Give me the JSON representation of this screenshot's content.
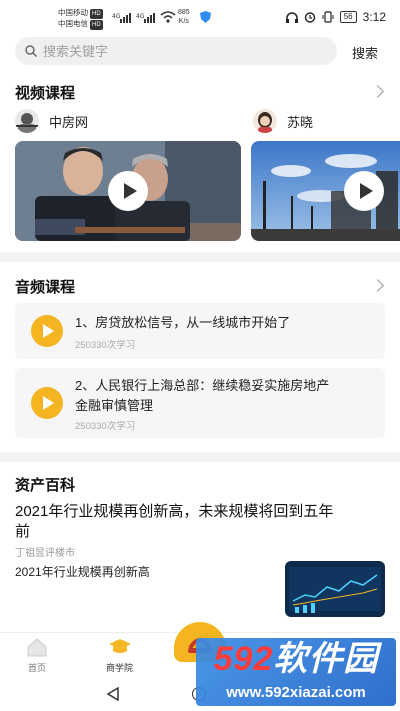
{
  "status_bar": {
    "carrier1": "中国移动",
    "carrier2": "中国电信",
    "hd": "HD",
    "net_speed_value": "885",
    "net_speed_unit": "K/s",
    "battery": "56",
    "time": "3:12"
  },
  "search": {
    "placeholder": "搜索关键字",
    "button": "搜索"
  },
  "video_section": {
    "title": "视频课程",
    "courses": [
      {
        "author": "中房网"
      },
      {
        "author": "苏晓"
      }
    ]
  },
  "audio_section": {
    "title": "音频课程",
    "items": [
      {
        "title": "1、房贷放松信号，从一线城市开始了",
        "plays": "250330次学习"
      },
      {
        "title_line1": "2、人民银行上海总部：继续稳妥实施房地产",
        "title_line2": "金融审慎管理",
        "plays": "250330次学习"
      }
    ]
  },
  "asset_section": {
    "title": "资产百科",
    "article_title_line1": "2021年行业规模再创新高，未来规模将回到五年",
    "article_title_line2": "前",
    "article_source": "丁祖昱评楼市",
    "article2_title": "2021年行业规模再创新高"
  },
  "bottom_nav": {
    "items": [
      {
        "label": "首页"
      },
      {
        "label": "商学院"
      }
    ]
  },
  "watermark": {
    "brand_num": "592",
    "brand_text": "软件园",
    "url": "www.592xiazai.com"
  },
  "colors": {
    "accent": "#f5b522",
    "background": "#f3f3f5"
  }
}
